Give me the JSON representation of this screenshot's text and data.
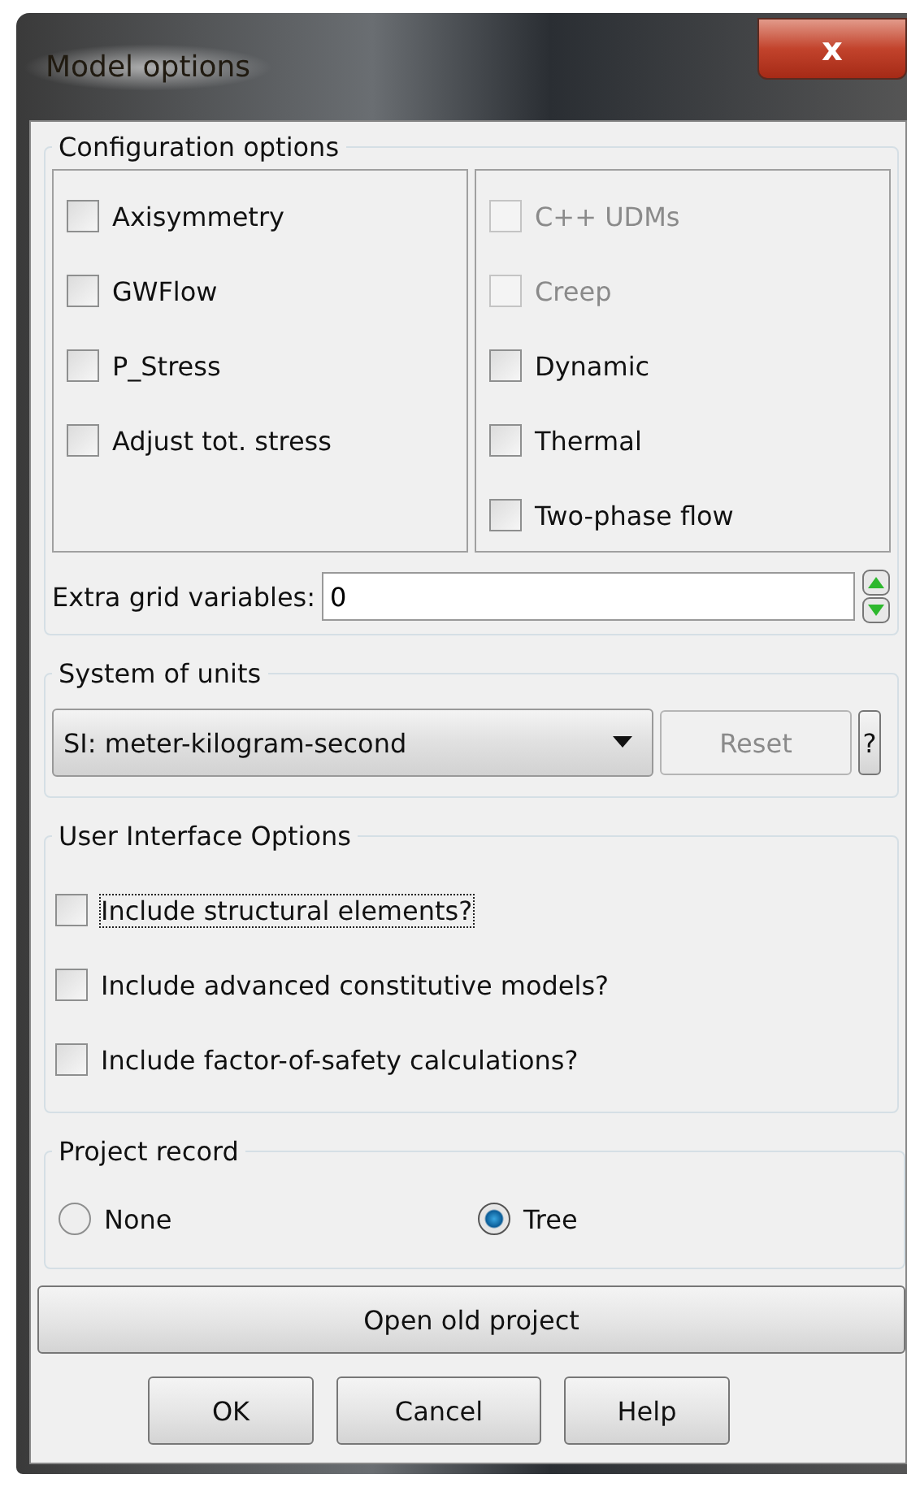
{
  "window": {
    "title": "Model options",
    "close_label": "x"
  },
  "configuration_options": {
    "label": "Configuration options",
    "left": [
      {
        "label": "Axisymmetry",
        "checked": false,
        "disabled": false
      },
      {
        "label": "GWFlow",
        "checked": false,
        "disabled": false
      },
      {
        "label": "P_Stress",
        "checked": false,
        "disabled": false
      },
      {
        "label": "Adjust tot. stress",
        "checked": false,
        "disabled": false
      }
    ],
    "right": [
      {
        "label": "C++ UDMs",
        "checked": false,
        "disabled": true
      },
      {
        "label": "Creep",
        "checked": false,
        "disabled": true
      },
      {
        "label": "Dynamic",
        "checked": false,
        "disabled": false
      },
      {
        "label": "Thermal",
        "checked": false,
        "disabled": false
      },
      {
        "label": "Two-phase flow",
        "checked": false,
        "disabled": false
      }
    ],
    "extra_grid_variables": {
      "label": "Extra grid variables:",
      "value": "0"
    }
  },
  "system_of_units": {
    "label": "System of units",
    "selected": "SI: meter-kilogram-second",
    "reset": {
      "label": "Reset",
      "disabled": true
    },
    "help": "?"
  },
  "user_interface_options": {
    "label": "User Interface Options",
    "items": [
      {
        "label": "Include structural elements?",
        "checked": false,
        "focused": true
      },
      {
        "label": "Include advanced constitutive models?",
        "checked": false,
        "focused": false
      },
      {
        "label": "Include factor-of-safety calculations?",
        "checked": false,
        "focused": false
      }
    ]
  },
  "project_record": {
    "label": "Project record",
    "options": [
      {
        "label": "None",
        "selected": false
      },
      {
        "label": "Tree",
        "selected": true
      }
    ]
  },
  "open_old_project": "Open old project",
  "buttons": [
    "OK",
    "Cancel",
    "Help"
  ]
}
